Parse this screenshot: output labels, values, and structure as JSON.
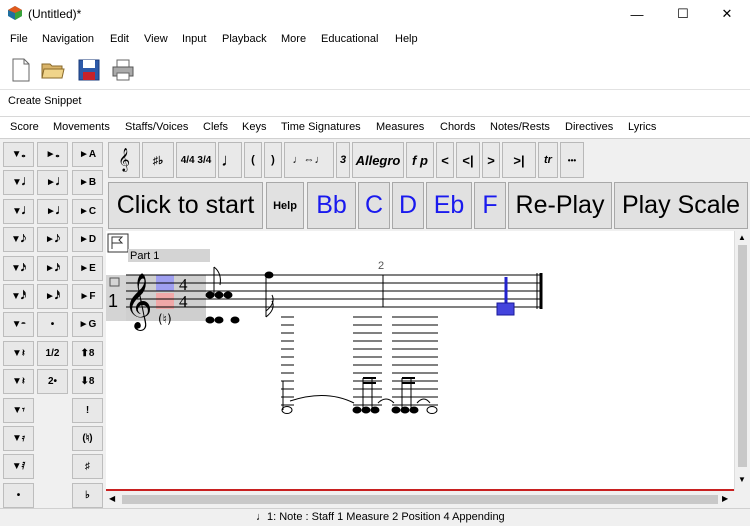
{
  "window": {
    "title": "(Untitled)*",
    "minimize": "—",
    "maximize": "☐",
    "close": "✕"
  },
  "menubar": [
    "File",
    "Navigation",
    "Edit",
    "View",
    "Input",
    "Playback",
    "More",
    "Educational",
    "Help"
  ],
  "snippet": {
    "label": "Create Snippet"
  },
  "palettes": [
    "Score",
    "Movements",
    "Staffs/Voices",
    "Clefs",
    "Keys",
    "Time Signatures",
    "Measures",
    "Chords",
    "Notes/Rests",
    "Directives",
    "Lyrics"
  ],
  "left_buttons": [
    [
      "▼𝅝",
      "►𝅝",
      "►A"
    ],
    [
      "▼𝅗𝅥",
      "►𝅗𝅥",
      "►B"
    ],
    [
      "▼𝅘𝅥",
      "►𝅘𝅥",
      "►C"
    ],
    [
      "▼𝅘𝅥𝅮",
      "►𝅘𝅥𝅮",
      "►D"
    ],
    [
      "▼𝅘𝅥𝅯",
      "►𝅘𝅥𝅯",
      "►E"
    ],
    [
      "▼𝅘𝅥𝅰",
      "►𝅘𝅥𝅰",
      "►F"
    ],
    [
      "▼𝄼",
      "•",
      "►G"
    ],
    [
      "▼𝄽",
      "1/2",
      "⬆8"
    ],
    [
      "▼𝄽",
      "2•",
      "⬇8"
    ],
    [
      "▼𝄾",
      "",
      "!"
    ],
    [
      "▼𝄿",
      "",
      "(♮)"
    ],
    [
      "▼𝅀",
      "",
      "♯"
    ],
    [
      "•",
      "",
      "♭"
    ]
  ],
  "toolrow": [
    "𝄞",
    "♯♭",
    "4/4 3/4",
    "♩",
    "(",
    ")",
    "♩⇔♩",
    "3",
    "Allegro",
    "f p",
    "<",
    "<|",
    ">",
    ">|",
    "tr",
    "•••"
  ],
  "bigrow": {
    "start": "Click to start",
    "help": "Help",
    "notes": [
      "Bb",
      "C",
      "D",
      "Eb",
      "F"
    ],
    "replay": "Re-Play",
    "scale": "Play Scale"
  },
  "score": {
    "part_label": "Part 1",
    "staff_number": "1",
    "measure_number": "2",
    "time_sig_top": "4",
    "time_sig_bottom": "4",
    "natural_mark": "(♮)"
  },
  "statusbar": {
    "text": "♩1: Note :  Staff 1 Measure 2 Position 4 Appending"
  },
  "colors": {
    "accent_blue": "#1a1aee",
    "red_line": "#c82020",
    "cursor_fill": "#4444dd"
  }
}
